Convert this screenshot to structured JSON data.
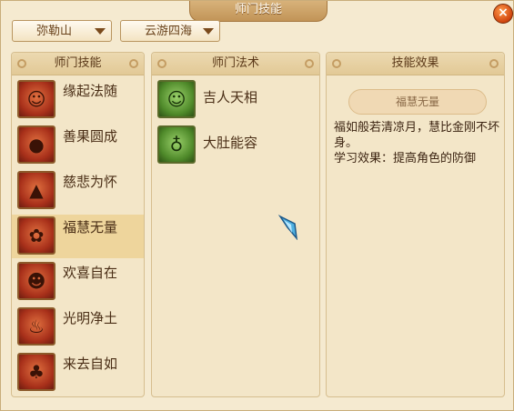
{
  "window": {
    "title": "师门技能",
    "close_label": "×"
  },
  "filters": {
    "sect": "弥勒山",
    "region": "云游四海"
  },
  "panels": {
    "skills_header": "师门技能",
    "spells_header": "师门法术",
    "effect_header": "技能效果"
  },
  "skills": [
    {
      "label": "缘起法随",
      "icon": "figure-icon"
    },
    {
      "label": "善果圆成",
      "icon": "fruit-icon"
    },
    {
      "label": "慈悲为怀",
      "icon": "palms-icon"
    },
    {
      "label": "福慧无量",
      "icon": "flower-icon",
      "selected": true
    },
    {
      "label": "欢喜自在",
      "icon": "laughing-buddha-icon"
    },
    {
      "label": "光明净土",
      "icon": "flame-icon"
    },
    {
      "label": "来去自如",
      "icon": "wind-figure-icon"
    }
  ],
  "spells": [
    {
      "label": "吉人天相",
      "icon": "blessing-figure-icon"
    },
    {
      "label": "大肚能容",
      "icon": "gourd-icon"
    }
  ],
  "effect": {
    "name": "福慧无量",
    "description": "福如般若清凉月，慧比金刚不坏身。",
    "learn_effect": "学习效果：提高角色的防御"
  },
  "colors": {
    "selected_row": "#eed59c",
    "skill_icon": "#c0462a",
    "spell_icon": "#4f8a2a"
  }
}
